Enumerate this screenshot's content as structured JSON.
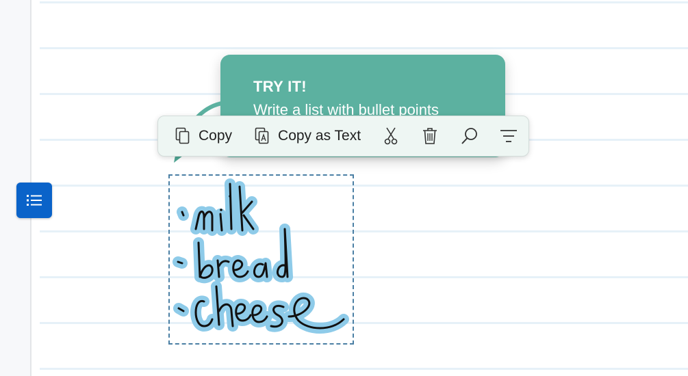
{
  "colors": {
    "accent_blue": "#0a63c9",
    "tooltip_green": "#5cb1a0",
    "ink_highlight": "#8ecbe9",
    "ink_stroke": "#111111"
  },
  "tooltip": {
    "title": "TRY IT!",
    "body": "Write a list with bullet points"
  },
  "toolbar": {
    "copy_label": "Copy",
    "copy_icon": "copy-icon",
    "copy_as_text_label": "Copy as Text",
    "copy_as_text_icon": "copy-as-text-icon",
    "cut_icon": "scissors-icon",
    "delete_icon": "trash-icon",
    "search_icon": "search-icon",
    "filter_icon": "filter-icon"
  },
  "list_button_icon": "bulleted-list-icon",
  "ink": {
    "items": [
      "milk",
      "bread",
      "cheese"
    ]
  }
}
